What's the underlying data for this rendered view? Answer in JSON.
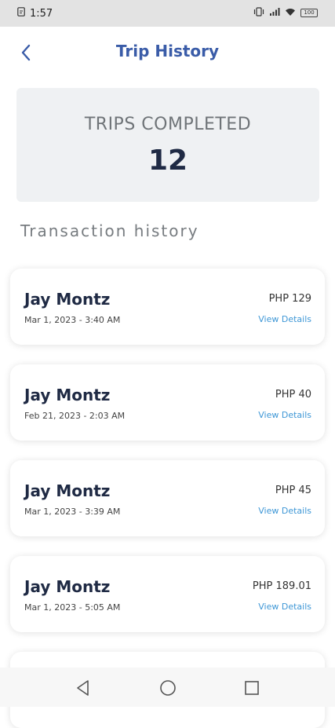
{
  "status_bar": {
    "time": "1:57",
    "battery": "100",
    "icons": [
      "notification-icon",
      "vibrate-icon",
      "network-icon",
      "wifi-icon",
      "battery-icon"
    ]
  },
  "header": {
    "title": "Trip History",
    "back_icon": "chevron-left-icon"
  },
  "stats": {
    "label": "TRIPS COMPLETED",
    "value": "12"
  },
  "transactions_heading": "Transaction history",
  "transactions": [
    {
      "name": "Jay Montz",
      "date": "Mar 1, 2023  - 3:40 AM",
      "amount": "PHP 129",
      "link": "View Details"
    },
    {
      "name": "Jay Montz",
      "date": "Feb 21, 2023  - 2:03 AM",
      "amount": "PHP 40",
      "link": "View Details"
    },
    {
      "name": "Jay Montz",
      "date": "Mar 1, 2023  - 3:39 AM",
      "amount": "PHP 45",
      "link": "View Details"
    },
    {
      "name": "Jay Montz",
      "date": "Mar 1, 2023  - 5:05 AM",
      "amount": "PHP 189.01",
      "link": "View Details"
    }
  ],
  "nav": [
    "back-nav-icon",
    "home-nav-icon",
    "recents-nav-icon"
  ],
  "colors": {
    "title": "#3a5ca8",
    "link": "#3e97d6",
    "card": "#eff1f3",
    "text": "#1f2a44"
  }
}
